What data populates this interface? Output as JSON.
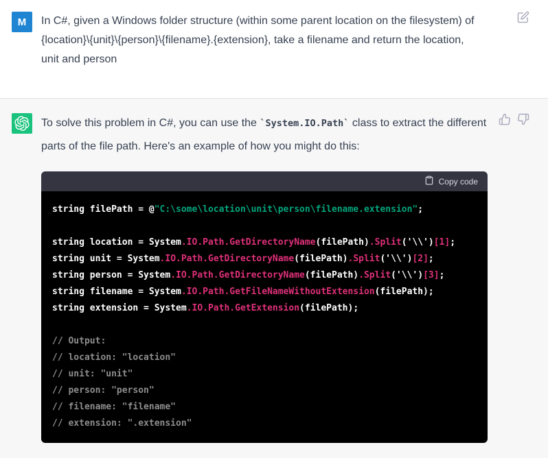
{
  "colors": {
    "user_avatar_bg": "#1f85d3",
    "assistant_avatar_bg": "#19c37d",
    "code_header_bg": "#343541",
    "code_body_bg": "#000000",
    "code_string": "#00a67d",
    "code_member": "#df3079",
    "code_comment": "#8e8e8e"
  },
  "user": {
    "avatar_initial": "M",
    "message": "In C#, given a Windows folder structure (within some parent location on the filesystem) of {location}\\{unit}\\{person}\\{filename}.{extension}, take a filename and return the location, unit and person"
  },
  "assistant": {
    "paragraph": {
      "prefix": "To solve this problem in C#, you can use the ",
      "inline_code": "`System.IO.Path`",
      "suffix": " class to extract the different parts of the file path. Here's an example of how you might do this:"
    }
  },
  "icons": {
    "edit": "edit-pencil-icon",
    "thumbs_up": "thumbs-up-icon",
    "thumbs_down": "thumbs-down-icon",
    "clipboard": "clipboard-icon",
    "assistant_logo": "openai-logo-icon"
  },
  "code_block": {
    "copy_label": "Copy code",
    "lines": [
      [
        {
          "t": "string filePath = @",
          "k": "p"
        },
        {
          "t": "\"C:\\some\\location\\unit\\person\\filename.extension\"",
          "k": "s"
        },
        {
          "t": ";",
          "k": "p"
        }
      ],
      [],
      [
        {
          "t": "string location = System",
          "k": "p"
        },
        {
          "t": ".IO.Path.GetDirectoryName",
          "k": "m"
        },
        {
          "t": "(filePath)",
          "k": "p"
        },
        {
          "t": ".Split",
          "k": "m"
        },
        {
          "t": "('\\\\')",
          "k": "p"
        },
        {
          "t": "[1]",
          "k": "m"
        },
        {
          "t": ";",
          "k": "p"
        }
      ],
      [
        {
          "t": "string unit = System",
          "k": "p"
        },
        {
          "t": ".IO.Path.GetDirectoryName",
          "k": "m"
        },
        {
          "t": "(filePath)",
          "k": "p"
        },
        {
          "t": ".Split",
          "k": "m"
        },
        {
          "t": "('\\\\')",
          "k": "p"
        },
        {
          "t": "[2]",
          "k": "m"
        },
        {
          "t": ";",
          "k": "p"
        }
      ],
      [
        {
          "t": "string person = System",
          "k": "p"
        },
        {
          "t": ".IO.Path.GetDirectoryName",
          "k": "m"
        },
        {
          "t": "(filePath)",
          "k": "p"
        },
        {
          "t": ".Split",
          "k": "m"
        },
        {
          "t": "('\\\\')",
          "k": "p"
        },
        {
          "t": "[3]",
          "k": "m"
        },
        {
          "t": ";",
          "k": "p"
        }
      ],
      [
        {
          "t": "string filename = System",
          "k": "p"
        },
        {
          "t": ".IO.Path.GetFileNameWithoutExtension",
          "k": "m"
        },
        {
          "t": "(filePath);",
          "k": "p"
        }
      ],
      [
        {
          "t": "string extension = System",
          "k": "p"
        },
        {
          "t": ".IO.Path.GetExtension",
          "k": "m"
        },
        {
          "t": "(filePath);",
          "k": "p"
        }
      ],
      [],
      [
        {
          "t": "// Output:",
          "k": "c"
        }
      ],
      [
        {
          "t": "// location: \"location\"",
          "k": "c"
        }
      ],
      [
        {
          "t": "// unit: \"unit\"",
          "k": "c"
        }
      ],
      [
        {
          "t": "// person: \"person\"",
          "k": "c"
        }
      ],
      [
        {
          "t": "// filename: \"filename\"",
          "k": "c"
        }
      ],
      [
        {
          "t": "// extension: \".extension\"",
          "k": "c"
        }
      ]
    ]
  }
}
